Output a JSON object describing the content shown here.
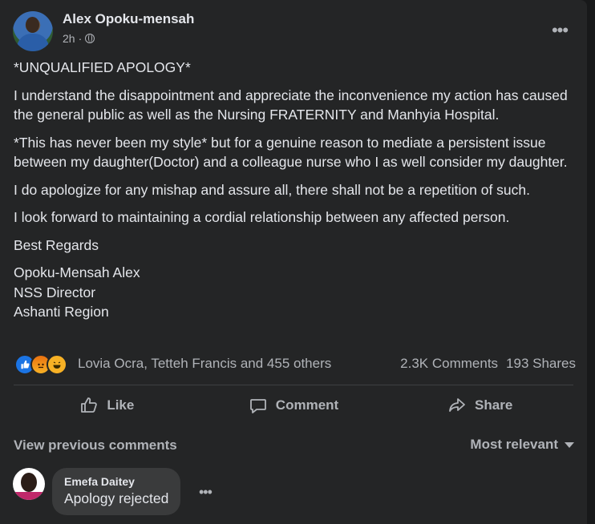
{
  "post": {
    "author": "Alex Opoku-mensah",
    "time": "2h",
    "more_icon": "ellipsis-icon",
    "body": [
      "*UNQUALIFIED  APOLOGY*",
      "I understand the disappointment and appreciate the inconvenience my action has caused the general public as well as the Nursing FRATERNITY and Manhyia Hospital.",
      "*This has never been my style* but for a genuine reason to mediate a persistent issue between my daughter(Doctor) and a colleague nurse who I as well consider my daughter.",
      "I do apologize for any mishap and assure all, there shall not be a repetition of such.",
      "I look forward to maintaining a cordial relationship between any affected person.",
      "Best Regards"
    ],
    "signature": [
      "Opoku-Mensah Alex",
      "NSS Director",
      "Ashanti Region"
    ]
  },
  "reactions": {
    "names": "Lovia Ocra, Tetteh Francis and 455 others",
    "comments": "2.3K Comments",
    "shares": "193 Shares",
    "icons": [
      "like-reaction-icon",
      "angry-reaction-icon",
      "haha-reaction-icon"
    ]
  },
  "actions": {
    "like": "Like",
    "comment": "Comment",
    "share": "Share"
  },
  "comments_section": {
    "view_previous": "View previous comments",
    "sort": "Most relevant",
    "items": [
      {
        "name": "Emefa Daitey",
        "text": "Apology rejected"
      }
    ]
  },
  "colors": {
    "background": "#18191a",
    "card": "#242526",
    "bubble": "#3a3b3c",
    "primary_text": "#e4e6eb",
    "secondary_text": "#b0b3b8",
    "like_blue": "#1b74e4"
  }
}
